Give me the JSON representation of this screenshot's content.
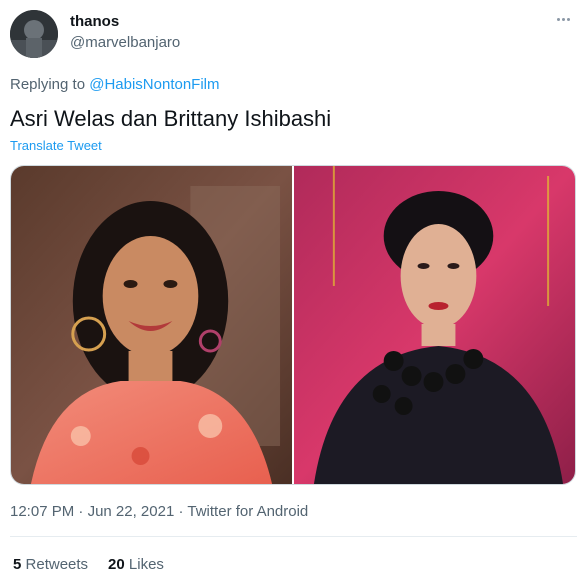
{
  "user": {
    "display_name": "thanos",
    "handle": "@marvelbanjaro"
  },
  "reply": {
    "prefix": "Replying to",
    "to_handle": "@HabisNontonFilm"
  },
  "tweet": {
    "text": "Asri Welas dan Brittany Ishibashi",
    "translate_label": "Translate Tweet"
  },
  "media": {
    "photos": [
      {
        "subject": "woman-smiling-floral-dress"
      },
      {
        "subject": "woman-black-top-pink-background"
      }
    ]
  },
  "meta": {
    "time": "12:07 PM",
    "separator1": "·",
    "date": "Jun 22, 2021",
    "separator2": "·",
    "source": "Twitter for Android"
  },
  "stats": {
    "retweets_count": "5",
    "retweets_label": "Retweets",
    "likes_count": "20",
    "likes_label": "Likes"
  },
  "colors": {
    "link": "#1d9bf0",
    "secondary_text": "#536471",
    "primary_text": "#0f1419"
  }
}
